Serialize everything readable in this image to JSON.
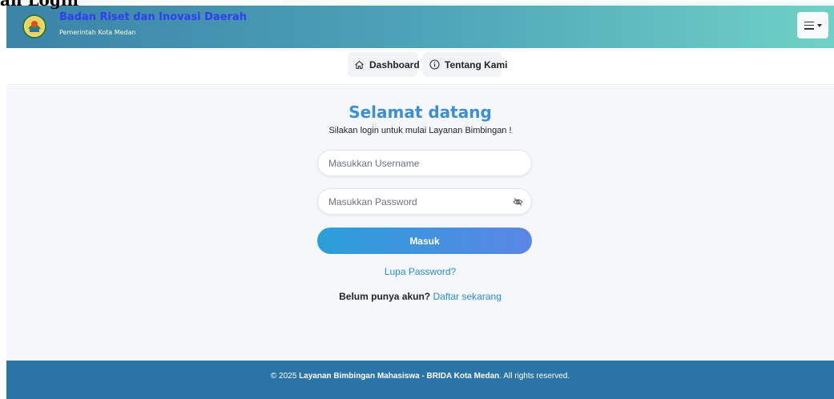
{
  "page": {
    "heading": "an Login"
  },
  "header": {
    "title": "Badan Riset dan Inovasi Daerah",
    "subtitle": "Pemerintah Kota Medan",
    "logo_icon": "city-emblem-icon",
    "menu_icon": "hamburger-icon"
  },
  "nav": {
    "items": [
      {
        "label": "Dashboard",
        "icon": "home-icon"
      },
      {
        "label": "Tentang Kami",
        "icon": "info-icon"
      }
    ]
  },
  "login": {
    "title": "Selamat datang",
    "subtitle": "Silakan login untuk mulai Layanan Bimbingan !",
    "username_placeholder": "Masukkan Username",
    "password_placeholder": "Masukkan Password",
    "password_toggle_icon": "eye-slash-icon",
    "submit_label": "Masuk",
    "forgot_label": "Lupa Password?",
    "register_question": "Belum punya akun?",
    "register_link": "Daftar sekarang"
  },
  "footer": {
    "symbol": "©",
    "year": "2025",
    "brand": "Layanan Bimbingan Mahasiswa - BRIDA Kota Medan",
    "suffix": ". All rights reserved."
  },
  "colors": {
    "title_blue": "#3c8fd6",
    "link_blue": "#2a8ed6",
    "footer_bg": "#2a74a6",
    "header_gradient_start": "#3b83a8",
    "header_gradient_end": "#6fd1c6"
  }
}
